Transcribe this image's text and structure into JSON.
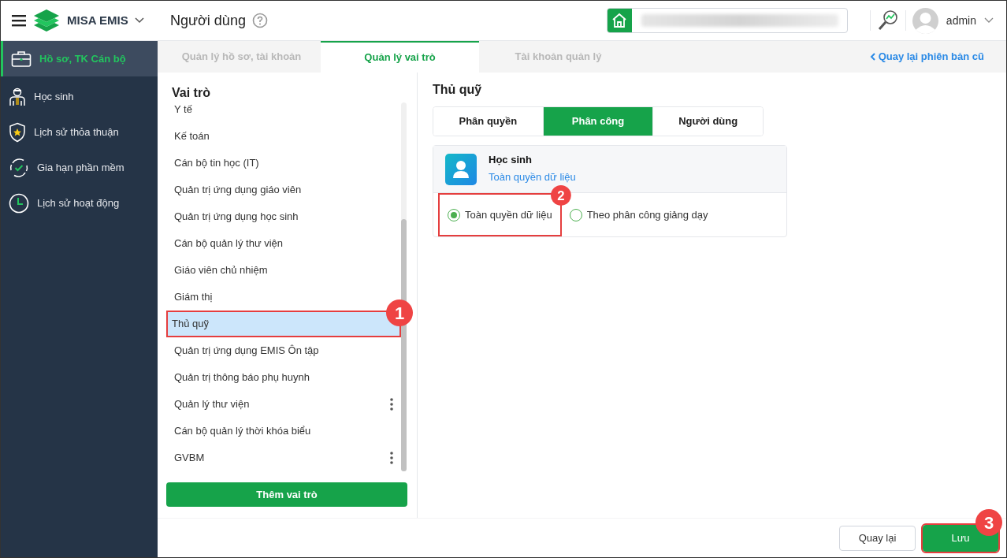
{
  "header": {
    "brand": "MISA EMIS",
    "page_title": "Người dùng",
    "user": "admin"
  },
  "sidebar": {
    "items": [
      {
        "label": "Hồ sơ, TK Cán bộ",
        "selected": true
      },
      {
        "label": "Học sinh",
        "selected": false
      },
      {
        "label": "Lịch sử thỏa thuận",
        "selected": false
      },
      {
        "label": "Gia hạn phần mềm",
        "selected": false
      },
      {
        "label": "Lịch sử hoạt động",
        "selected": false
      }
    ]
  },
  "tabs": [
    {
      "label": "Quản lý hồ sơ, tài khoản",
      "selected": false
    },
    {
      "label": "Quản lý vai trò",
      "selected": true
    },
    {
      "label": "Tài khoản quản lý",
      "selected": false
    }
  ],
  "back_link": "Quay lại phiên bản cũ",
  "roles": {
    "title": "Vai trò",
    "items": [
      {
        "label": "Y tế",
        "selected": false,
        "has_menu": false
      },
      {
        "label": "Kế toán",
        "selected": false,
        "has_menu": false
      },
      {
        "label": "Cán bộ tin học (IT)",
        "selected": false,
        "has_menu": false
      },
      {
        "label": "Quản trị ứng dụng giáo viên",
        "selected": false,
        "has_menu": false
      },
      {
        "label": "Quản trị ứng dụng học sinh",
        "selected": false,
        "has_menu": false
      },
      {
        "label": "Cán bộ quản lý thư viện",
        "selected": false,
        "has_menu": false
      },
      {
        "label": "Giáo viên chủ nhiệm",
        "selected": false,
        "has_menu": false
      },
      {
        "label": "Giám thị",
        "selected": false,
        "has_menu": false
      },
      {
        "label": "Thủ quỹ",
        "selected": true,
        "has_menu": false
      },
      {
        "label": "Quản trị ứng dụng EMIS Ôn tập",
        "selected": false,
        "has_menu": false
      },
      {
        "label": "Quản trị thông báo phụ huynh",
        "selected": false,
        "has_menu": false
      },
      {
        "label": "Quản lý thư viện",
        "selected": false,
        "has_menu": true
      },
      {
        "label": "Cán bộ quản lý thời khóa biểu",
        "selected": false,
        "has_menu": false
      },
      {
        "label": "GVBM",
        "selected": false,
        "has_menu": true
      }
    ],
    "add_button": "Thêm vai trò"
  },
  "detail": {
    "title": "Thủ quỹ",
    "tabs": [
      {
        "label": "Phân quyền",
        "selected": false
      },
      {
        "label": "Phân công",
        "selected": true
      },
      {
        "label": "Người dùng",
        "selected": false
      }
    ],
    "card": {
      "name": "Học sinh",
      "summary": "Toàn quyền dữ liệu",
      "options": [
        {
          "label": "Toàn quyền dữ liệu",
          "selected": true
        },
        {
          "label": "Theo phân công giảng dạy",
          "selected": false
        }
      ]
    }
  },
  "footer": {
    "buttons": [
      {
        "label": "Quay lại",
        "kind": "secondary"
      },
      {
        "label": "Lưu",
        "kind": "primary"
      }
    ]
  },
  "callouts": [
    "1",
    "2",
    "3"
  ]
}
